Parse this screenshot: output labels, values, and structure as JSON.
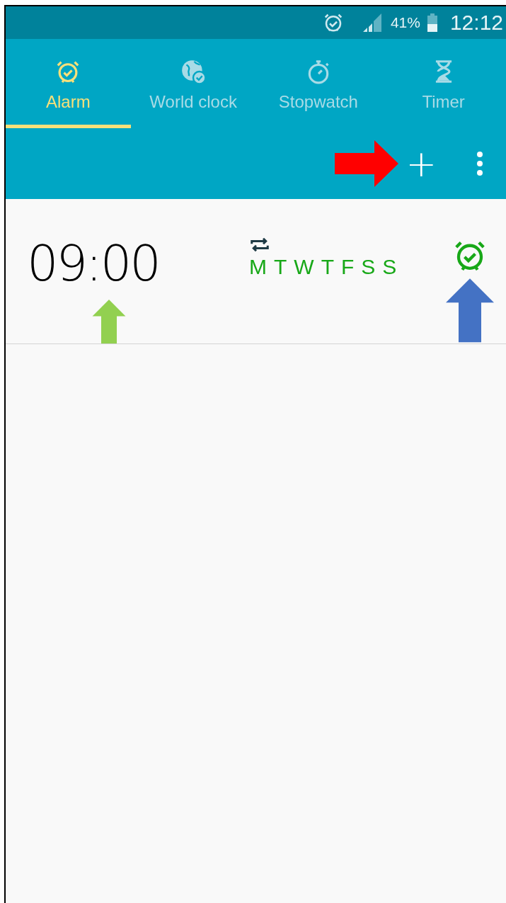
{
  "status_bar": {
    "battery_text": "41%",
    "time": "12:12"
  },
  "tabs": [
    {
      "label": "Alarm",
      "kind": "alarm",
      "selected": true
    },
    {
      "label": "World clock",
      "kind": "globe",
      "selected": false
    },
    {
      "label": "Stopwatch",
      "kind": "stopwatch",
      "selected": false
    },
    {
      "label": "Timer",
      "kind": "hourglass",
      "selected": false
    }
  ],
  "toolbar": {
    "add_label": "+",
    "arrows": [
      {
        "color": "#ff0000"
      }
    ]
  },
  "alarms": [
    {
      "time": "09:00",
      "time_arrows": [
        {
          "color": "#92d050"
        }
      ],
      "repeat": true,
      "days": [
        {
          "label": "M",
          "on": true
        },
        {
          "label": "T",
          "on": true
        },
        {
          "label": "W",
          "on": true
        },
        {
          "label": "T",
          "on": true
        },
        {
          "label": "F",
          "on": true
        },
        {
          "label": "S",
          "on": true
        },
        {
          "label": "S",
          "on": true
        }
      ],
      "on": true,
      "toggle_arrows": [
        {
          "color": "#4472c4"
        }
      ]
    }
  ]
}
